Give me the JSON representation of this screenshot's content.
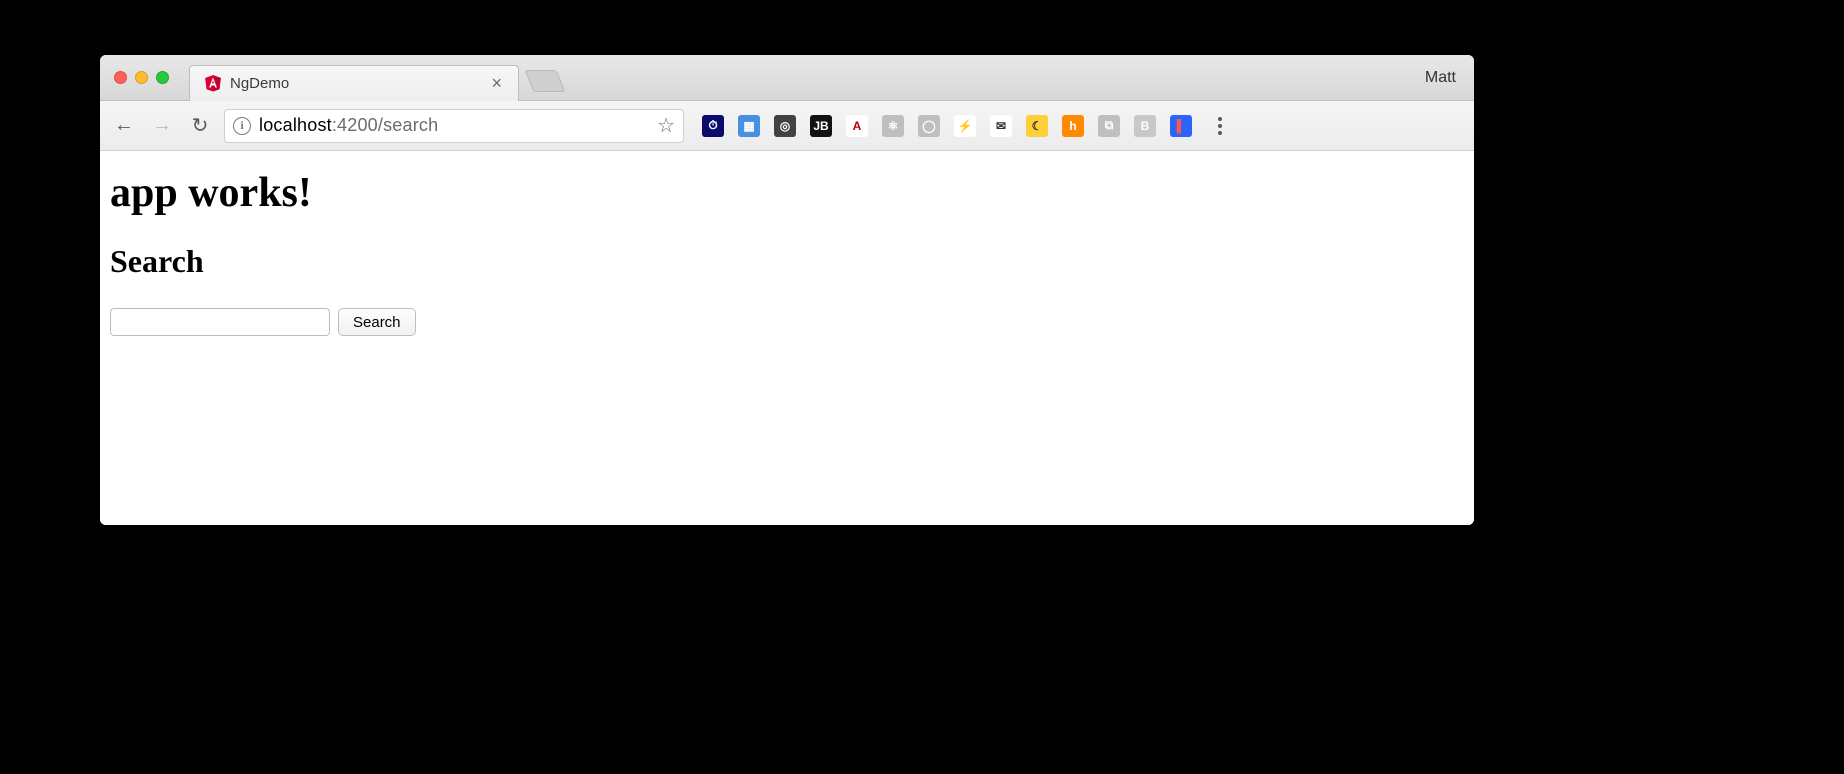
{
  "window": {
    "traffic": {
      "close": "close",
      "minimize": "minimize",
      "zoom": "zoom"
    },
    "profile_name": "Matt"
  },
  "tab": {
    "title": "NgDemo",
    "favicon_name": "angular-icon"
  },
  "toolbar": {
    "url_host": "localhost",
    "url_rest": ":4200/search",
    "info_glyph": "i",
    "star_glyph": "☆",
    "extensions": [
      {
        "name": "pagespeed-icon",
        "bg": "#0b0b6b",
        "glyph": "⏱"
      },
      {
        "name": "dev-tool-icon",
        "bg": "#4a90e2",
        "glyph": "▦"
      },
      {
        "name": "adblock-icon",
        "bg": "#424242",
        "glyph": "◎"
      },
      {
        "name": "jetbrains-icon",
        "bg": "#111",
        "glyph": "JB"
      },
      {
        "name": "font-a-icon",
        "bg": "#ffffff",
        "glyph": "A",
        "fg": "#b30000"
      },
      {
        "name": "react-devtools-icon",
        "bg": "#bfbfbf",
        "glyph": "⚛"
      },
      {
        "name": "greyscale-icon",
        "bg": "#bfbfbf",
        "glyph": "◯"
      },
      {
        "name": "bolt-icon",
        "bg": "#ffffff",
        "glyph": "⚡",
        "fg": "#c0c0c0"
      },
      {
        "name": "mail-icon",
        "bg": "#ffffff",
        "glyph": "✉",
        "fg": "#333"
      },
      {
        "name": "moon-icon",
        "bg": "#ffcf3a",
        "glyph": "☾",
        "fg": "#333"
      },
      {
        "name": "honey-icon",
        "bg": "#ff8a00",
        "glyph": "h"
      },
      {
        "name": "video-icon",
        "bg": "#bfbfbf",
        "glyph": "⧉"
      },
      {
        "name": "blogger-icon",
        "bg": "#c8c8c8",
        "glyph": "B"
      },
      {
        "name": "lighthouse-icon",
        "bg": "#2b63ff",
        "glyph": "▌",
        "fg": "#ff5a3c"
      }
    ],
    "back_glyph": "←",
    "forward_glyph": "→",
    "reload_glyph": "↻"
  },
  "page": {
    "heading": "app works!",
    "subheading": "Search",
    "search_value": "",
    "search_button_label": "Search"
  }
}
